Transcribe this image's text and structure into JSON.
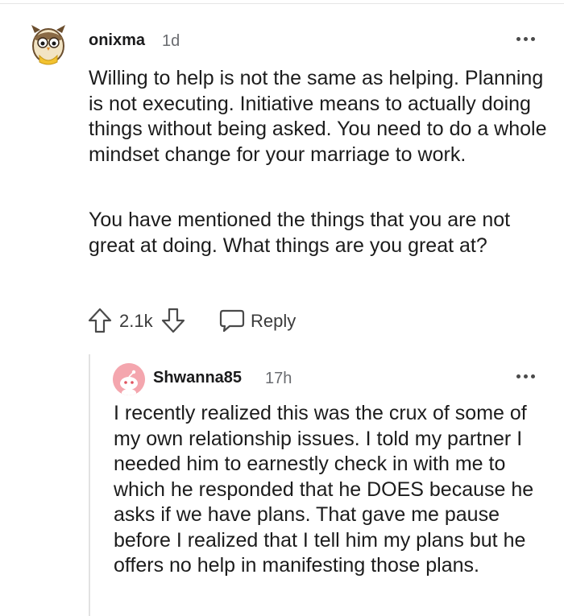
{
  "comment": {
    "username": "onixma",
    "time": "1d",
    "paragraphs": [
      "Willing to help is not the same as helping. Planning is not executing. Initiative means to actually doing things without being asked. You need to do a whole mindset change for your marriage to work.",
      "You have mentioned the things that you are not great at doing. What things are you great at?"
    ],
    "score": "2.1k",
    "reply_label": "Reply"
  },
  "reply": {
    "username": "Shwanna85",
    "time": "17h",
    "text": "I recently realized this was the crux of some of my own relationship issues. I told my partner I needed him to earnestly check in with me to which he responded that he DOES because he asks if we have plans. That gave me pause before I realized that I tell him my plans but he offers no help in manifesting those plans."
  },
  "colors": {
    "text": "#1c1c1c",
    "meta": "#6a6c70",
    "thread_line": "#e2e2e2",
    "avatar_pink": "#f4a6ae",
    "avatar_yellow": "#f2c230"
  },
  "icons": [
    "owl-avatar-icon",
    "snoo-avatar-icon",
    "overflow-menu-icon",
    "upvote-arrow-icon",
    "downvote-arrow-icon",
    "comment-bubble-icon"
  ]
}
